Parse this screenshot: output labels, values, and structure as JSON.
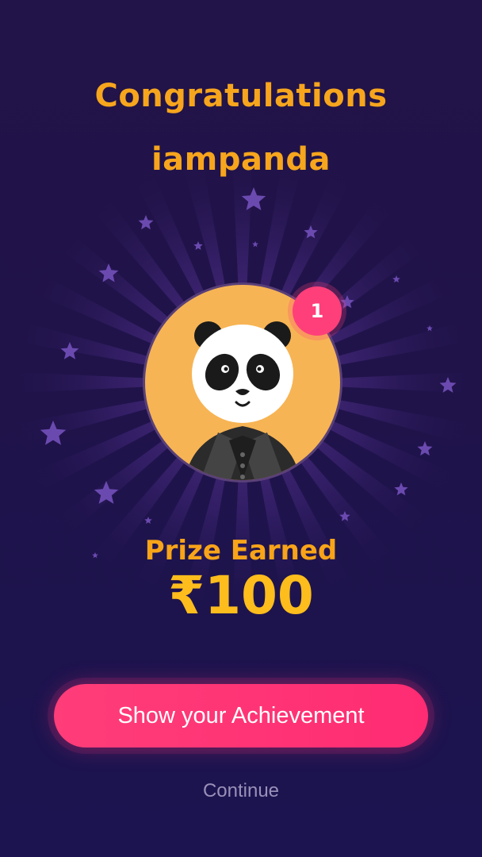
{
  "header": {
    "line1": "Congratulations",
    "line2": "iampanda"
  },
  "avatar": {
    "icon": "panda-avatar-icon",
    "rank_badge": "1"
  },
  "prize": {
    "label": "Prize Earned",
    "amount": "₹100"
  },
  "actions": {
    "share_label": "Show your Achievement",
    "continue_label": "Continue"
  },
  "colors": {
    "background": "#20134a",
    "title": "#f6a51d",
    "amount": "#fdbd1c",
    "button": "#ff3579",
    "badge": "#ff3f7a",
    "avatar_bg": "#f7b454"
  }
}
